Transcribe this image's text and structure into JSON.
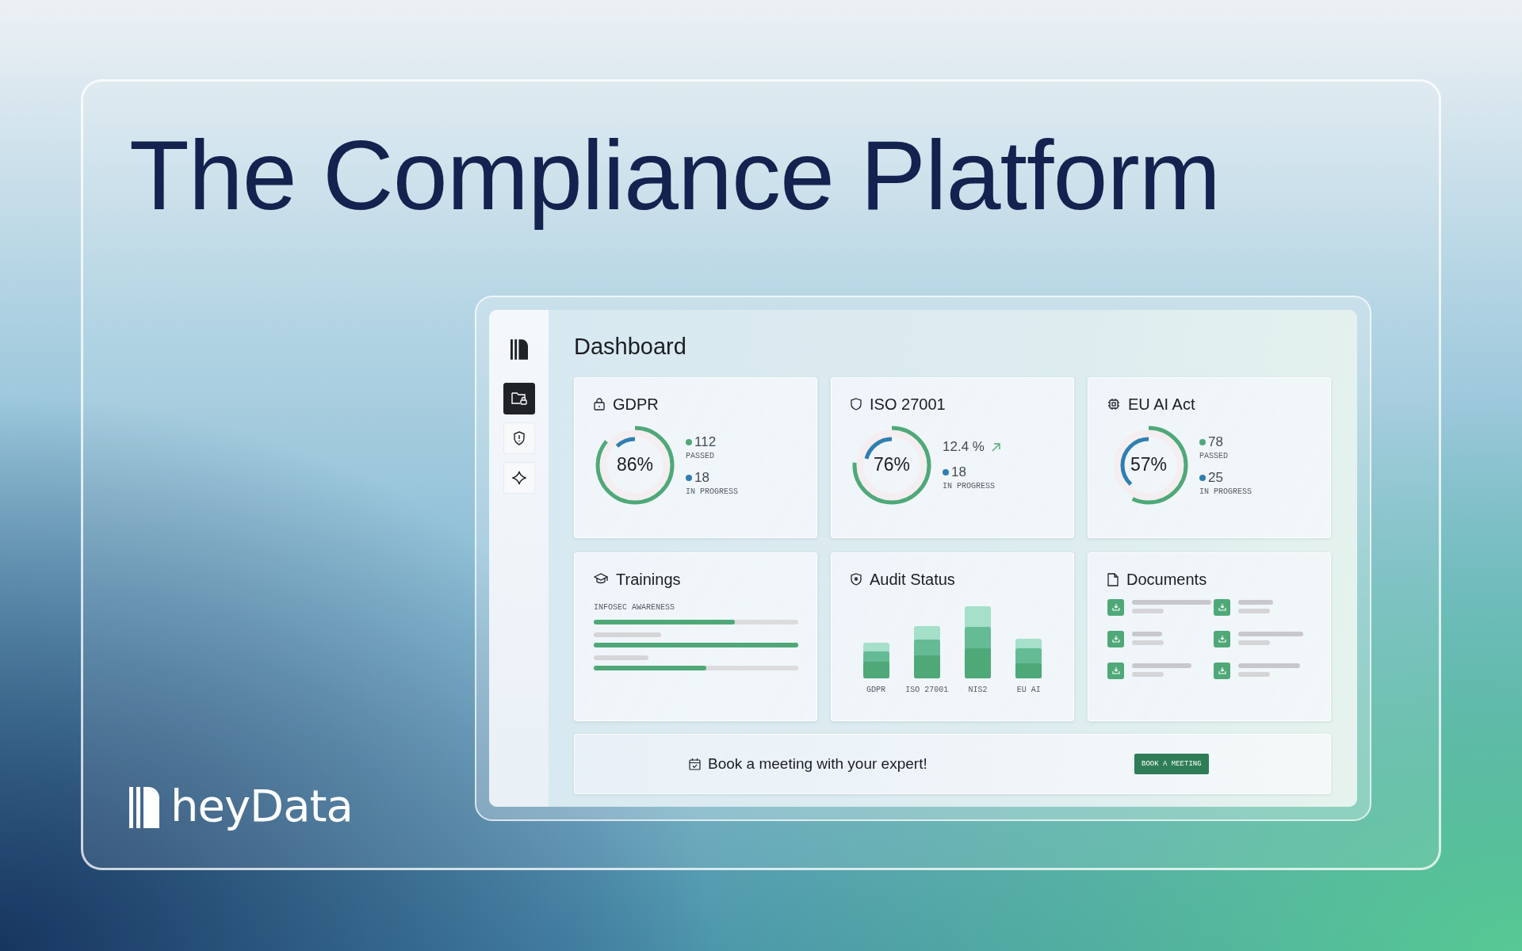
{
  "headline": "The Compliance Platform",
  "brand": {
    "name": "heyData"
  },
  "sidebar": {
    "items": [
      {
        "selected": true
      },
      {
        "selected": false
      },
      {
        "selected": false
      }
    ]
  },
  "dashboard": {
    "title": "Dashboard",
    "cards": [
      {
        "kind": "score",
        "title": "GDPR",
        "percent": "86%",
        "rings": [
          {
            "kind": "passed",
            "level": 0.86
          },
          {
            "kind": "progress",
            "level": 0.12
          }
        ],
        "stats": [
          {
            "kind": "count",
            "value": "112",
            "label": "PASSED",
            "color": "#4fa878"
          },
          {
            "kind": "count",
            "value": "18",
            "label": "IN PROGRESS",
            "color": "#2f7fb0"
          }
        ]
      },
      {
        "kind": "score",
        "title": "ISO 27001",
        "percent": "76%",
        "rings": [
          {
            "kind": "passed",
            "level": 0.76
          },
          {
            "kind": "progress",
            "level": 0.21
          }
        ],
        "stats": [
          {
            "kind": "trend",
            "value": "12.4 %"
          },
          {
            "kind": "count",
            "value": "18",
            "label": "IN PROGRESS",
            "color": "#2f7fb0"
          }
        ]
      },
      {
        "kind": "score",
        "title": "EU AI Act",
        "percent": "57%",
        "rings": [
          {
            "kind": "passed",
            "level": 0.57
          },
          {
            "kind": "progress",
            "level": 0.38
          }
        ],
        "stats": [
          {
            "kind": "count",
            "value": "78",
            "label": "PASSED",
            "color": "#4fa878"
          },
          {
            "kind": "count",
            "value": "25",
            "label": "IN PROGRESS",
            "color": "#2f7fb0"
          }
        ]
      },
      {
        "kind": "trainings",
        "title": "Trainings",
        "subtitle": "INFOSEC AWARENESS",
        "bars": [
          {
            "level": 0.69
          },
          {
            "level": 1
          },
          {
            "level": 0.55
          }
        ]
      },
      {
        "kind": "audit",
        "title": "Audit Status",
        "categories": [
          "GDPR",
          "ISO 27001",
          "NIS2",
          "EU AI"
        ]
      },
      {
        "kind": "documents",
        "title": "Documents"
      }
    ],
    "banner": {
      "text": "Book a meeting with your expert!",
      "button": "BOOK A MEETING"
    }
  }
}
